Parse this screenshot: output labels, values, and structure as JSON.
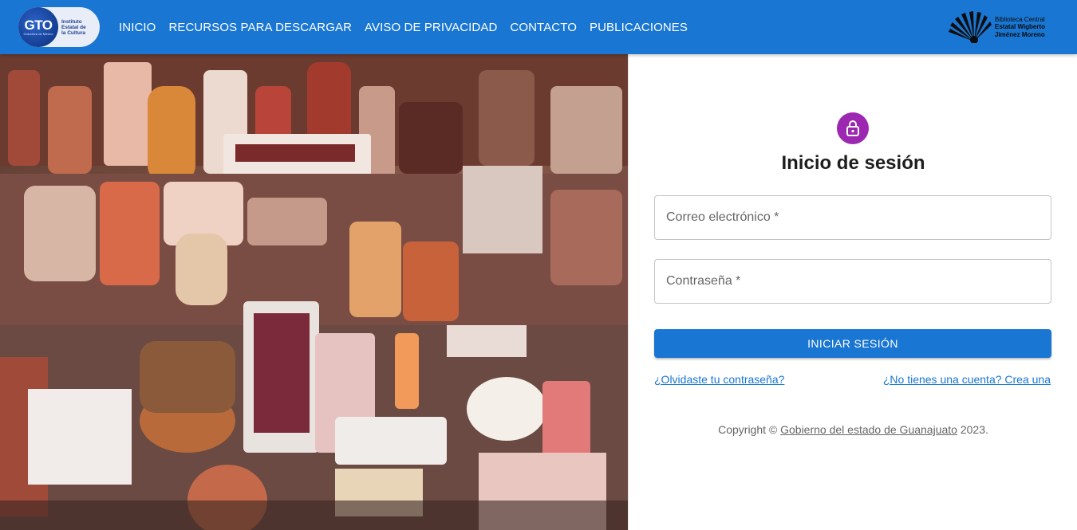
{
  "header": {
    "logo_left": {
      "mark": "GTO",
      "mark_sub": "Grandeza de México",
      "text": [
        "Instituto",
        "Estatal de",
        "la Cultura"
      ]
    },
    "nav": [
      "INICIO",
      "RECURSOS PARA DESCARGAR",
      "AVISO DE PRIVACIDAD",
      "CONTACTO",
      "PUBLICACIONES"
    ],
    "logo_right": [
      "Biblioteca Central",
      "Estatal Wigberto",
      "Jiménez Moreno"
    ]
  },
  "login": {
    "icon": "lock-icon",
    "title": "Inicio de sesión",
    "email_label": "Correo electrónico *",
    "password_label": "Contraseña *",
    "submit_label": "INICIAR SESIÓN",
    "forgot_link": "¿Olvidaste tu contraseña?",
    "signup_link": "¿No tienes una cuenta? Crea una"
  },
  "footer": {
    "prefix": "Copyright © ",
    "link": "Gobierno del estado de Guanajuato",
    "suffix": " 2023."
  },
  "colors": {
    "primary": "#1976d2",
    "avatar": "#9c27b0"
  }
}
